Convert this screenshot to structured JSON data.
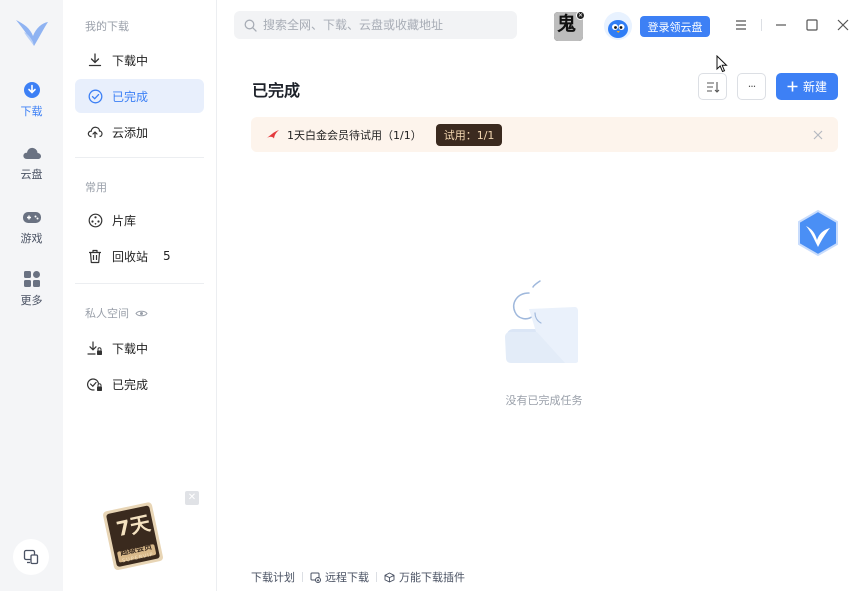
{
  "rail": {
    "items": [
      {
        "label": "下载",
        "icon": "download-circle-icon",
        "active": true
      },
      {
        "label": "云盘",
        "icon": "cloud-icon",
        "active": false
      },
      {
        "label": "游戏",
        "icon": "gamepad-icon",
        "active": false
      },
      {
        "label": "更多",
        "icon": "apps-grid-icon",
        "active": false
      }
    ]
  },
  "sidebar": {
    "group_downloads": "我的下载",
    "items_downloads": [
      {
        "label": "下载中",
        "icon": "download-arrow-icon"
      },
      {
        "label": "已完成",
        "icon": "check-circle-icon",
        "active": true
      },
      {
        "label": "云添加",
        "icon": "cloud-upload-icon"
      }
    ],
    "group_common": "常用",
    "items_common": [
      {
        "label": "片库",
        "icon": "film-reel-icon"
      },
      {
        "label": "回收站",
        "icon": "trash-icon",
        "count": "5"
      }
    ],
    "group_private": "私人空间",
    "items_private": [
      {
        "label": "下载中",
        "icon": "download-lock-icon"
      },
      {
        "label": "已完成",
        "icon": "check-lock-icon"
      }
    ],
    "promo": {
      "line1": "7天",
      "line2": "超级会员",
      "line3": "SUPERVIP"
    }
  },
  "topbar": {
    "search_placeholder": "搜索全网、下载、云盘或收藏地址",
    "game_avatar_text": "鬼",
    "login_label": "登录领云盘"
  },
  "main": {
    "title": "已完成",
    "new_label": "新建",
    "more_label": "···",
    "banner": {
      "text": "1天白金会员待试用（1/1）",
      "tag": "试用：1/1"
    },
    "empty_text": "没有已完成任务"
  },
  "footer": {
    "items": [
      "下载计划",
      "远程下载",
      "万能下载插件"
    ]
  },
  "colors": {
    "accent": "#3d80f5",
    "rail_bg": "#f4f5f7",
    "banner_bg": "#fdf4ec"
  }
}
